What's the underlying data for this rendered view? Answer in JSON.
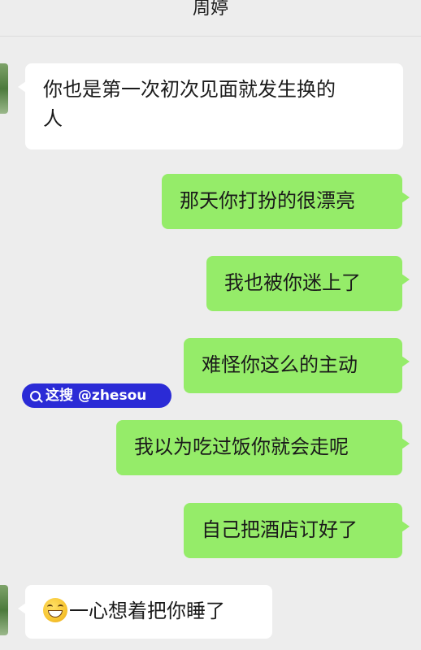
{
  "header": {
    "title": "周婷"
  },
  "messages": [
    {
      "side": "in",
      "text_line1": "你也是第一次初次见面就发生换的",
      "text_line2": "人"
    },
    {
      "side": "out",
      "text": "那天你打扮的很漂亮"
    },
    {
      "side": "out",
      "text": "我也被你迷上了"
    },
    {
      "side": "out",
      "text": "难怪你这么的主动"
    },
    {
      "side": "out",
      "text": "我以为吃过饭你就会走呢"
    },
    {
      "side": "out",
      "text": "自己把酒店订好了"
    },
    {
      "side": "in",
      "emoji": "grinning-face-icon",
      "text": "一心想着把你睡了"
    }
  ],
  "watermark": {
    "text": "这搜 @zhesou",
    "icon": "search-icon"
  },
  "colors": {
    "background": "#ededed",
    "incoming_bubble": "#ffffff",
    "outgoing_bubble": "#95ec69",
    "watermark": "#2b2bd6"
  }
}
